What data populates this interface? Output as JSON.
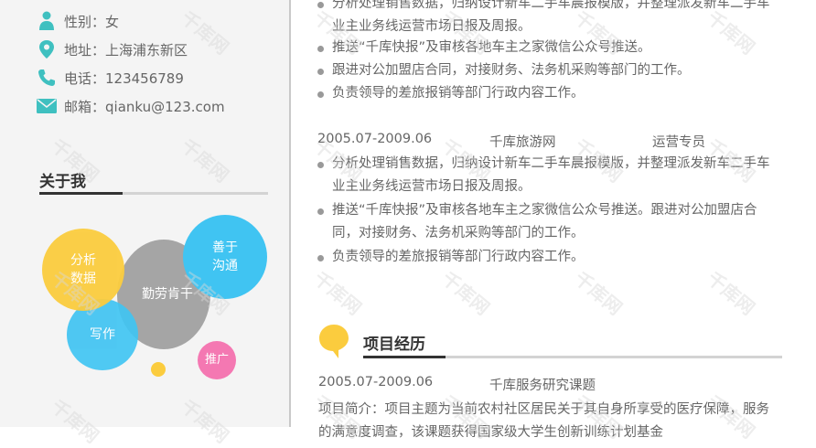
{
  "contact": {
    "gender": "性别：女",
    "address": "地址：上海浦东新区",
    "phone": "电话：123456789",
    "email": "邮箱：qianku@123.com"
  },
  "about": {
    "title": "关于我",
    "bubbles": {
      "analysis": "分析\n数据",
      "diligent": "勤劳肯干",
      "good": "善于\n沟通",
      "writing": "写作",
      "promo": "推广"
    }
  },
  "work": {
    "partial_top": "分析处理销售数据，归纳设计新车二手车晨报模版，并整理派发新车二手车",
    "item1_bullets": [
      "业主业务线运营市场日报及周报。",
      "推送“千库快报”及审核各地车主之家微信公众号推送。",
      "跟进对公加盟店合同，对接财务、法务机采购等部门的工作。",
      "负责领导的差旅报销等部门行政内容工作。"
    ],
    "item2": {
      "period": "2005.07-2009.06",
      "company": "千库旅游网",
      "role": "运营专员",
      "bullets": [
        "分析处理销售数据，归纳设计新车二手车晨报模版，并整理派发新车二手车",
        "业主业务线运营市场日报及周报。",
        "推送“千库快报”及审核各地车主之家微信公众号推送。跟进对公加盟店合",
        "同，对接财务、法务机采购等部门的工作。",
        "负责领导的差旅报销等部门行政内容工作。"
      ]
    }
  },
  "project": {
    "title": "项目经历",
    "period": "2005.07-2009.06",
    "name": "千库服务研究课题",
    "intro1": "项目简介：项目主题为当前农村社区居民关于其自身所享受的医疗保障，服务",
    "intro2": "的满意度调查，该课题获得国家级大学生创新训练计划基金"
  },
  "watermark": "千库网",
  "colors": {
    "yellow": "#fbcc3e",
    "gray": "#a5a5a5",
    "blue": "#40c4f2",
    "pink": "#f478b2",
    "teal": "#3fc0c0"
  }
}
